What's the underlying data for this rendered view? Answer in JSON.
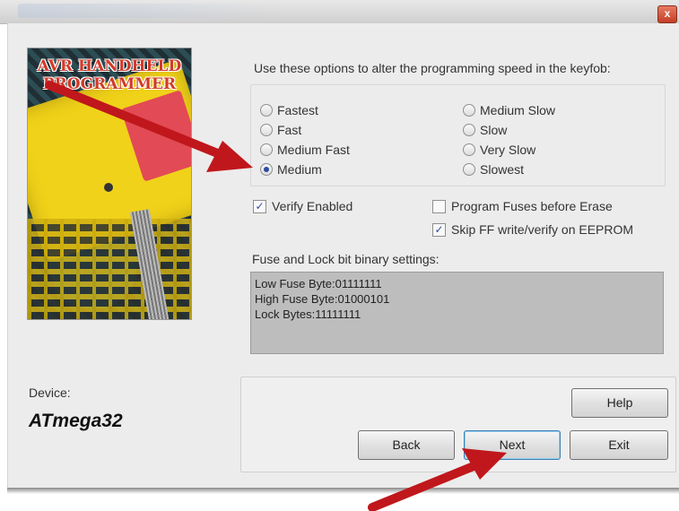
{
  "window": {
    "close_glyph": "x"
  },
  "picture": {
    "title_line1": "AVR HANDHELD",
    "title_line2": "PROGRAMMER"
  },
  "speed": {
    "intro": "Use these options to alter the programming speed in the keyfob:",
    "left_options": [
      {
        "label": "Fastest",
        "selected": false
      },
      {
        "label": "Fast",
        "selected": false
      },
      {
        "label": "Medium Fast",
        "selected": false
      },
      {
        "label": "Medium",
        "selected": true
      }
    ],
    "right_options": [
      {
        "label": "Medium Slow",
        "selected": false
      },
      {
        "label": "Slow",
        "selected": false
      },
      {
        "label": "Very Slow",
        "selected": false
      },
      {
        "label": "Slowest",
        "selected": false
      }
    ]
  },
  "options": {
    "verify": {
      "label": "Verify Enabled",
      "checked": true
    },
    "program_fuses": {
      "label": "Program Fuses before Erase",
      "checked": false
    },
    "skip_ff": {
      "label": "Skip FF write/verify on EEPROM",
      "checked": true
    }
  },
  "fuse": {
    "label": "Fuse and Lock bit binary settings:",
    "lines": [
      "Low Fuse Byte:01111111",
      "High Fuse Byte:01000101",
      "Lock Bytes:11111111"
    ]
  },
  "device": {
    "label": "Device:",
    "value": "ATmega32"
  },
  "buttons": {
    "help": "Help",
    "back": "Back",
    "next": "Next",
    "exit": "Exit"
  },
  "colors": {
    "arrow": "#c0171c",
    "radio_dot": "#2a4d9c",
    "fuse_box_bg": "#bdbdbd"
  }
}
